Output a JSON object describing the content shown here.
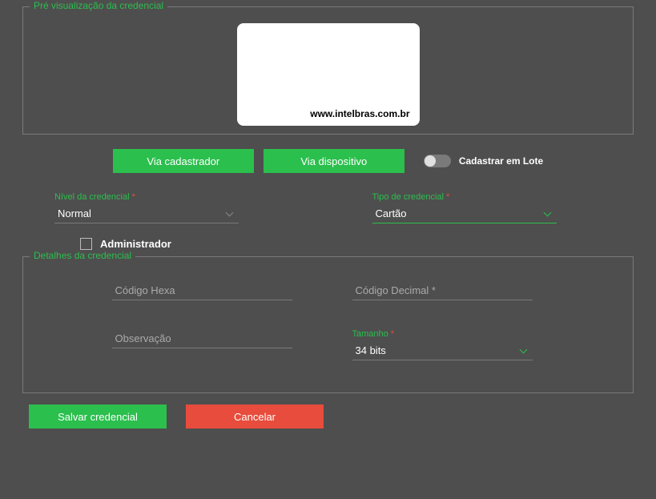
{
  "preview": {
    "legend": "Pré visualização da credencial",
    "card_url": "www.intelbras.com.br"
  },
  "actions": {
    "via_cadastrador": "Via cadastrador",
    "via_dispositivo": "Via dispositivo",
    "batch_label": "Cadastrar em Lote",
    "batch_enabled": false
  },
  "level": {
    "label": "Nível da credencial",
    "required": true,
    "value": "Normal"
  },
  "type": {
    "label": "Tipo de credencial",
    "required": true,
    "value": "Cartão"
  },
  "admin": {
    "label": "Administrador",
    "checked": false
  },
  "details": {
    "legend": "Detalhes da credencial",
    "hex": {
      "placeholder": "Código Hexa",
      "value": ""
    },
    "decimal": {
      "placeholder": "Código Decimal *",
      "value": ""
    },
    "note": {
      "placeholder": "Observação",
      "value": ""
    },
    "size": {
      "label": "Tamanho",
      "required": true,
      "value": "34 bits"
    }
  },
  "footer": {
    "save": "Salvar credencial",
    "cancel": "Cancelar"
  },
  "asterisk": "*"
}
